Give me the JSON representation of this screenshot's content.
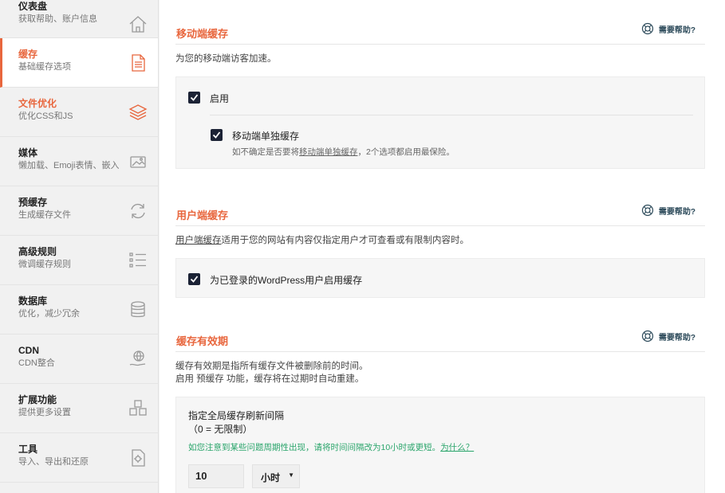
{
  "sidebar": {
    "items": [
      {
        "title": "仪表盘",
        "sub": "获取帮助、账户信息",
        "icon": "house-icon"
      },
      {
        "title": "缓存",
        "sub": "基础缓存选项",
        "icon": "document-icon",
        "active": true
      },
      {
        "title": "文件优化",
        "sub": "优化CSS和JS",
        "icon": "layers-icon"
      },
      {
        "title": "媒体",
        "sub": "懒加载、Emoji表情、嵌入",
        "icon": "image-icon"
      },
      {
        "title": "预缓存",
        "sub": "生成缓存文件",
        "icon": "refresh-icon"
      },
      {
        "title": "高级规则",
        "sub": "微调缓存规则",
        "icon": "list-icon"
      },
      {
        "title": "数据库",
        "sub": "优化，减少冗余",
        "icon": "database-icon"
      },
      {
        "title": "CDN",
        "sub": "CDN整合",
        "icon": "globe-hand-icon"
      },
      {
        "title": "扩展功能",
        "sub": "提供更多设置",
        "icon": "cubes-icon"
      },
      {
        "title": "工具",
        "sub": "导入、导出和还原",
        "icon": "tools-icon"
      }
    ]
  },
  "mobile": {
    "title": "移动端缓存",
    "help": "需要帮助?",
    "desc": "为您的移动端访客加速。",
    "enable_label": "启用",
    "separate_label": "移动端单独缓存",
    "hint_pre": "如不确定是否要将",
    "hint_link": "移动端单独缓存",
    "hint_post": "，2个选项都启用最保险。"
  },
  "user": {
    "title": "用户端缓存",
    "help": "需要帮助?",
    "desc_link": "用户端缓存",
    "desc_rest": "适用于您的网站有内容仅指定用户才可查看或有限制内容时。",
    "label": "为已登录的WordPress用户启用缓存"
  },
  "lifespan": {
    "title": "缓存有效期",
    "help": "需要帮助?",
    "desc1": "缓存有效期是指所有缓存文件被删除前的时间。",
    "desc2": "启用 预缓存 功能，缓存将在过期时自动重建。",
    "field_label": "指定全局缓存刷新间隔",
    "field_sub": "（0 = 无限制）",
    "warning": "如您注意到某些问题周期性出现，请将时间间隔改为10小时或更短。",
    "warning_link": "为什么？",
    "value": "10",
    "unit": "小时"
  },
  "colors": {
    "accent": "#e8663d",
    "checkbox": "#1b2235",
    "green": "#2aa56b"
  }
}
